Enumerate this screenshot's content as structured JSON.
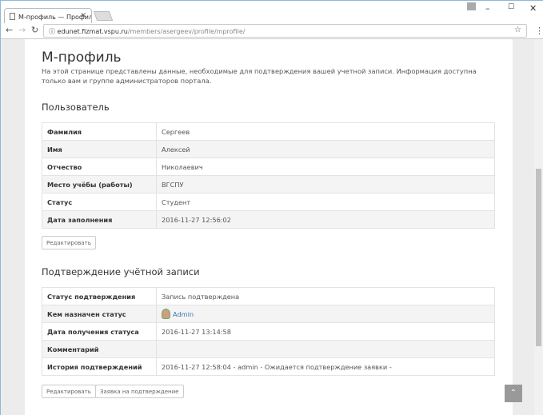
{
  "browser": {
    "tab_title": "М-профиль — Профиль",
    "url_host": "edunet.fizmat.vspu.ru",
    "url_path": "/members/asergeev/profile/mprofile/"
  },
  "page": {
    "title": "М-профиль",
    "intro": "На этой странице представлены данные, необходимые для подтверждения вашей учетной записи. Информация доступна только вам и группе администраторов портала."
  },
  "user": {
    "heading": "Пользователь",
    "rows": [
      {
        "label": "Фамилия",
        "value": "Сергеев"
      },
      {
        "label": "Имя",
        "value": "Алексей"
      },
      {
        "label": "Отчество",
        "value": "Николаевич"
      },
      {
        "label": "Место учёбы (работы)",
        "value": "ВГСПУ"
      },
      {
        "label": "Статус",
        "value": "Студент"
      },
      {
        "label": "Дата заполнения",
        "value": "2016-11-27 12:56:02"
      }
    ],
    "edit_button": "Редактировать"
  },
  "confirm": {
    "heading": "Подтверждение учётной записи",
    "rows": [
      {
        "label": "Статус подтверждения",
        "value": "Запись подтверждена"
      },
      {
        "label": "Кем назначен статус",
        "value": "Admin"
      },
      {
        "label": "Дата получения статуса",
        "value": "2016-11-27 13:14:58"
      },
      {
        "label": "Комментарий",
        "value": ""
      },
      {
        "label": "История подтверждений",
        "value": "2016-11-27 12:58:04 - admin - Ожидается подтверждение заявки -"
      }
    ],
    "edit_button": "Редактировать",
    "request_button": "Заявка на подтверждение"
  }
}
